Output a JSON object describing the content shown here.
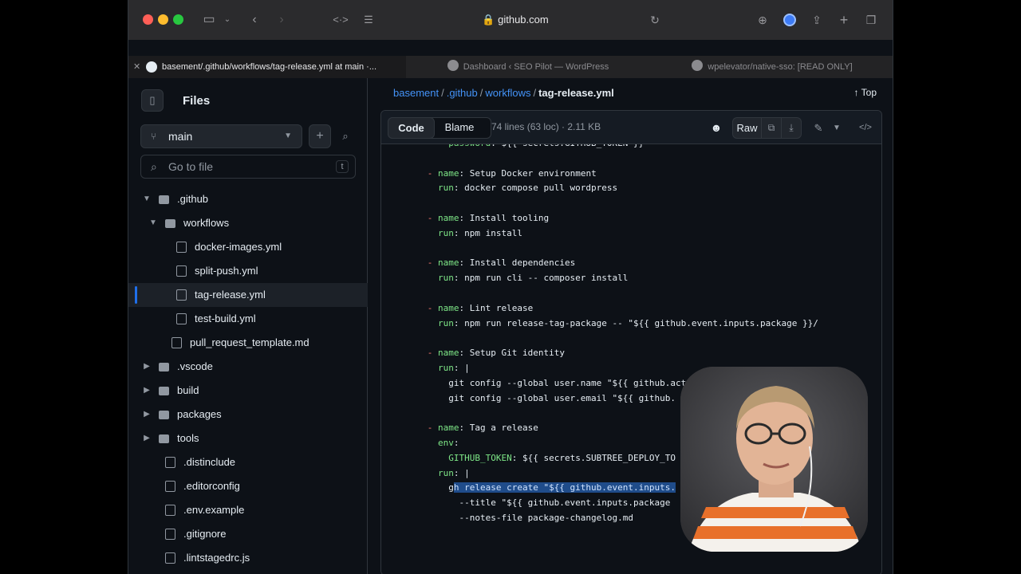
{
  "browser": {
    "url": "github.com",
    "tabs": [
      {
        "title": "basement/.github/workflows/tag-release.yml at main ·..."
      },
      {
        "title": "Dashboard ‹ SEO Pilot — WordPress"
      },
      {
        "title": "wpelevator/native-sso: [READ ONLY]"
      }
    ]
  },
  "sidebar": {
    "title": "Files",
    "branch": "main",
    "search_placeholder": "Go to file",
    "search_shortcut": "t",
    "tree": [
      {
        "label": ".github",
        "type": "folder",
        "open": true,
        "indent": 0
      },
      {
        "label": "workflows",
        "type": "folder",
        "open": true,
        "indent": 1
      },
      {
        "label": "docker-images.yml",
        "type": "file",
        "indent": 2
      },
      {
        "label": "split-push.yml",
        "type": "file",
        "indent": 2
      },
      {
        "label": "tag-release.yml",
        "type": "file",
        "indent": 2,
        "selected": true
      },
      {
        "label": "test-build.yml",
        "type": "file",
        "indent": 2
      },
      {
        "label": "pull_request_template.md",
        "type": "file",
        "indent": 1
      },
      {
        "label": ".vscode",
        "type": "folder",
        "open": false,
        "indent": 0
      },
      {
        "label": "build",
        "type": "folder",
        "open": false,
        "indent": 0
      },
      {
        "label": "packages",
        "type": "folder",
        "open": false,
        "indent": 0
      },
      {
        "label": "tools",
        "type": "folder",
        "open": false,
        "indent": 0
      },
      {
        "label": ".distinclude",
        "type": "file",
        "indent": 0
      },
      {
        "label": ".editorconfig",
        "type": "file",
        "indent": 0
      },
      {
        "label": ".env.example",
        "type": "file",
        "indent": 0
      },
      {
        "label": ".gitignore",
        "type": "file",
        "indent": 0
      },
      {
        "label": ".lintstagedrc.js",
        "type": "file",
        "indent": 0
      }
    ]
  },
  "main": {
    "breadcrumb": [
      {
        "label": "basement",
        "link": true
      },
      {
        "label": ".github",
        "link": true
      },
      {
        "label": "workflows",
        "link": true
      },
      {
        "label": "tag-release.yml",
        "link": false
      }
    ],
    "top_label": "Top",
    "tab_code": "Code",
    "tab_blame": "Blame",
    "file_meta": "74 lines (63 loc) · 2.11 KB",
    "raw_label": "Raw",
    "code_lines": [
      "          password: ${{ secrets.GITHUB_TOKEN }}",
      "",
      "      - name: Setup Docker environment",
      "        run: docker compose pull wordpress",
      "",
      "      - name: Install tooling",
      "        run: npm install",
      "",
      "      - name: Install dependencies",
      "        run: npm run cli -- composer install",
      "",
      "      - name: Lint release",
      "        run: npm run release-tag-package -- \"${{ github.event.inputs.package }}/",
      "",
      "      - name: Setup Git identity",
      "        run: |",
      "          git config --global user.name \"${{ github.act",
      "          git config --global user.email \"${{ github.",
      "",
      "      - name: Tag a release",
      "        env:",
      "          GITHUB_TOKEN: ${{ secrets.SUBTREE_DEPLOY_TO",
      "        run: |",
      "          gh release create \"${{ github.event.inputs.",
      "            --title \"${{ github.event.inputs.package",
      "            --notes-file package-changelog.md"
    ]
  },
  "colors": {
    "accent": "#4493f8",
    "selection": "#1f4c8a",
    "key": "#7ee787",
    "background": "#0d1117"
  }
}
